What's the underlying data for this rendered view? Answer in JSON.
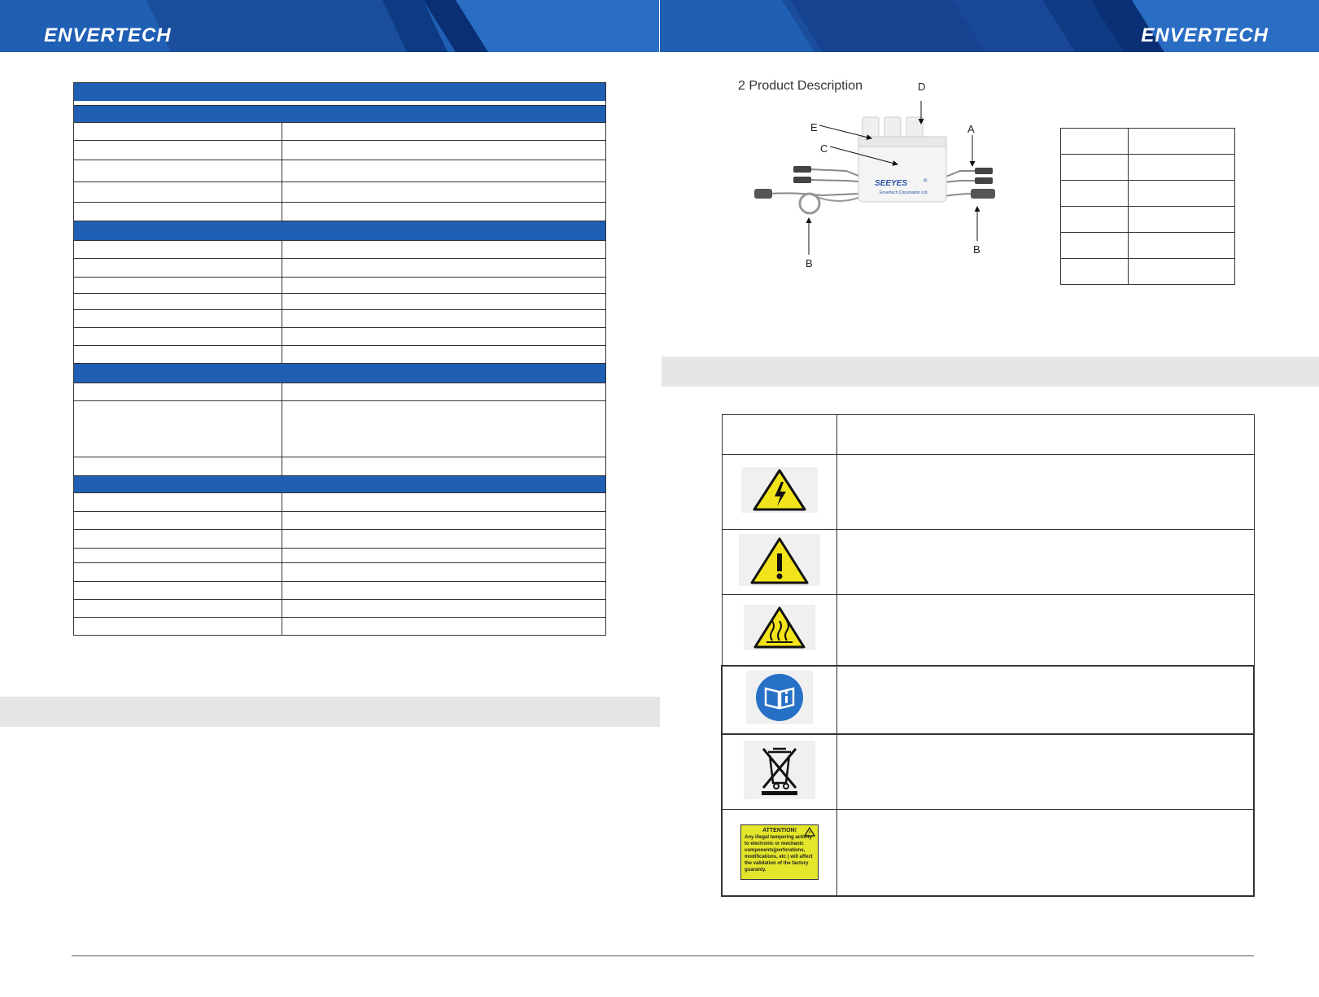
{
  "header": {
    "brand_left": "ENVERTECH",
    "brand_right": "ENVERTECH",
    "colors": {
      "primary": "#1f5fb4",
      "dark": "#0e3a84"
    }
  },
  "product_description": {
    "title": "2  Product Description",
    "device_brand": "SEEYES",
    "device_brand_mark": "®",
    "device_subtext": "Envertech Corporation Ltd.",
    "callouts": {
      "a": "A",
      "b1": "B",
      "b2": "B",
      "c": "C",
      "d": "D",
      "e": "E"
    }
  },
  "symbols": {
    "icons": [
      "high-voltage-warning-icon",
      "general-warning-icon",
      "hot-surface-warning-icon",
      "read-manual-icon",
      "weee-disposal-icon",
      "attention-label-icon"
    ],
    "attention_label": {
      "heading": "ATTENTION!",
      "body": "Any illegal tampering activity to electronic or mechanic components(perforations, modifications, etc ) will affect the validation of the factory guaranty."
    }
  }
}
